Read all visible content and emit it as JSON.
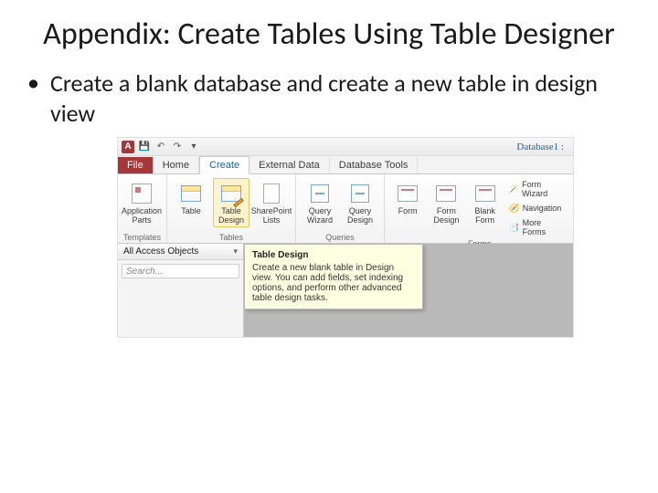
{
  "slide": {
    "title": "Appendix: Create Tables Using Table Designer",
    "bullets": [
      "Create a blank database and create a new table in design view"
    ]
  },
  "app": {
    "titlebar": {
      "database_label": "Database1 :"
    },
    "qat": {
      "save": "💾",
      "undo": "↶",
      "redo": "↷",
      "drop": "▾"
    },
    "tabs": {
      "file": "File",
      "home": "Home",
      "create": "Create",
      "external": "External Data",
      "dbtools": "Database Tools"
    },
    "ribbon": {
      "templates": {
        "app_parts": "Application\nParts",
        "caption": "Templates"
      },
      "tables": {
        "table": "Table",
        "table_design": "Table\nDesign",
        "sharepoint": "SharePoint\nLists",
        "caption": "Tables"
      },
      "queries": {
        "wizard": "Query\nWizard",
        "design": "Query\nDesign",
        "caption": "Queries"
      },
      "forms": {
        "form": "Form",
        "form_design": "Form\nDesign",
        "blank_form": "Blank\nForm",
        "form_wizard": "Form Wizard",
        "navigation": "Navigation",
        "more_forms": "More Forms",
        "caption": "Forms"
      }
    },
    "nav": {
      "header": "All Access Objects",
      "search_placeholder": "Search..."
    },
    "tooltip": {
      "title": "Table Design",
      "body": "Create a new blank table in Design view. You can add fields, set indexing options, and perform other advanced table design tasks."
    }
  }
}
